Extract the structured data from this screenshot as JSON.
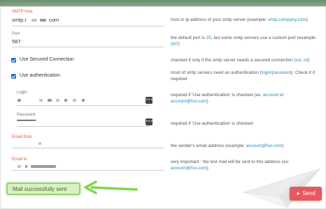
{
  "topbar": {
    "text": "...   ..   ...   ...   ..."
  },
  "smtp_host": {
    "label": "SMTP host",
    "value": "smtp.r",
    "value_suffix": "com",
    "description_parts": [
      "host or ip address of your smtp server (example: ",
      "smtp.company.com",
      ")"
    ]
  },
  "port": {
    "label": "Port",
    "value": "587",
    "description_parts": [
      "the default port is ",
      "25",
      ", but some smtp servers use a custom port (example: ",
      "587",
      ")"
    ]
  },
  "secured": {
    "label": "Use Secured Connection",
    "checked": true,
    "description_parts": [
      "checked it only if the smtp server needs a secured connection (",
      "ssl, tsl",
      ")"
    ]
  },
  "auth": {
    "label": "Use authentication",
    "checked": true,
    "description_parts": [
      "most of smtp servers need an authentication (",
      "login/password",
      "). Check it if required"
    ]
  },
  "login": {
    "label": "Login",
    "dots_label": "•••",
    "description_parts": [
      "required if 'Use authentication' is checked (ex: ",
      "account",
      " or ",
      "account@foo.com",
      ")"
    ]
  },
  "password": {
    "label": "Password",
    "value": "•••••••••••••••••",
    "dots_label": "•••",
    "description": "required if 'Use authentication' is checked"
  },
  "email_from": {
    "label": "Email from",
    "description_parts": [
      "the sender's email address (example: ",
      "account@foo.com",
      ")"
    ]
  },
  "email_to": {
    "label": "Email to",
    "description_parts": [
      "very important : the test mail will be sent to this address (ex: ",
      "account@foo.com",
      ")"
    ]
  },
  "status": {
    "message": "Mail successfully sent"
  },
  "send_button": {
    "label": "Send",
    "icon": "paper-plane-icon"
  },
  "colors": {
    "accent": "#e2583e",
    "link": "#2b8bbf",
    "checkbox": "#2b73c5",
    "success_bg": "#dcefc4",
    "success_border": "#8fd66f",
    "send": "#e65a5f",
    "arrow": "#7dd64f"
  }
}
